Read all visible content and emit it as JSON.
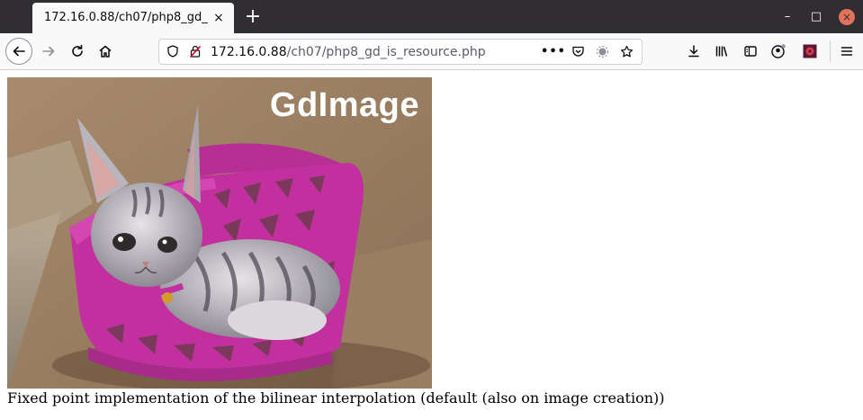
{
  "browser": {
    "tab_title": "172.16.0.88/ch07/php8_gd_",
    "tab_close": "×",
    "new_tab": "+",
    "window": {
      "minimize": "–",
      "maximize": "□",
      "close": "×"
    },
    "url": {
      "host": "172.16.0.88",
      "path": "/ch07/php8_gd_is_resource.php"
    },
    "icons": [
      "back-icon",
      "forward-icon",
      "reload-icon",
      "home-icon",
      "shield-icon",
      "insecure-lock-icon",
      "page-actions-icon",
      "pocket-icon",
      "extension-icon",
      "bookmark-star-icon",
      "download-icon",
      "library-icon",
      "sidebar-icon",
      "account-icon",
      "extension-square-icon",
      "menu-icon"
    ]
  },
  "page": {
    "image_label": "GdImage",
    "caption": "Fixed point implementation of the bilinear interpolation (default (also on image creation))"
  },
  "colors": {
    "tabstrip": "#302d33",
    "basket": "#c2309f",
    "background_wall": "#9a7f62"
  }
}
